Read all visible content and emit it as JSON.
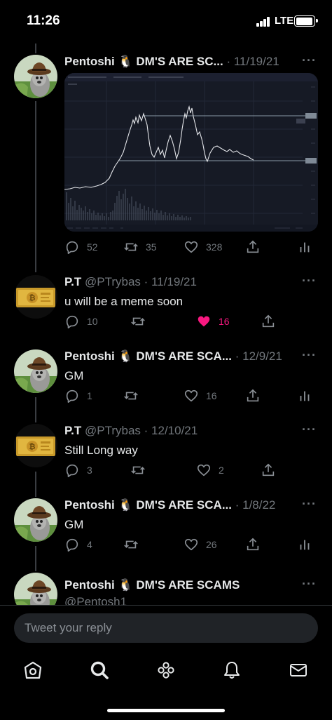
{
  "status_bar": {
    "time": "11:26",
    "network": "LTE"
  },
  "tweets": [
    {
      "author": "Pentoshi 🐧 DM'S ARE SC...",
      "handle": "",
      "date": "· 11/19/21",
      "text": "",
      "avatar": "pentoshi-avatar",
      "has_chart": true,
      "actions": {
        "reply": "52",
        "retweet": "35",
        "like": "328"
      }
    },
    {
      "author": "P.T",
      "handle": "@PTrybas",
      "date": "· 11/19/21",
      "text": "u will be a meme soon",
      "avatar": "bitcoin-bar-avatar",
      "actions": {
        "reply": "10",
        "retweet": "",
        "like": "16",
        "liked": true
      }
    },
    {
      "author": "Pentoshi 🐧 DM'S ARE SCA...",
      "handle": "",
      "date": "· 12/9/21",
      "text": "GM",
      "avatar": "pentoshi-avatar",
      "actions": {
        "reply": "1",
        "retweet": "",
        "like": "16"
      }
    },
    {
      "author": "P.T",
      "handle": "@PTrybas",
      "date": "· 12/10/21",
      "text": "Still Long way",
      "avatar": "bitcoin-bar-avatar",
      "actions": {
        "reply": "3",
        "retweet": "",
        "like": "2"
      }
    },
    {
      "author": "Pentoshi 🐧 DM'S ARE SCA...",
      "handle": "",
      "date": "· 1/8/22",
      "text": "GM",
      "avatar": "pentoshi-avatar",
      "actions": {
        "reply": "4",
        "retweet": "",
        "like": "26"
      }
    },
    {
      "author": "Pentoshi 🐧 DM'S ARE SCAMS",
      "handle": "@Pentosh1",
      "date": "",
      "text": "",
      "avatar": "pentoshi-avatar"
    }
  ],
  "reply": {
    "placeholder": "Tweet your reply"
  },
  "tabs": [
    "home-icon",
    "search-icon",
    "communities-icon",
    "notifications-icon",
    "messages-icon"
  ],
  "colors": {
    "background": "#000000",
    "text": "#e7e9ea",
    "muted": "#71767b",
    "like": "#f91880",
    "chart_bg": "#161a25"
  }
}
